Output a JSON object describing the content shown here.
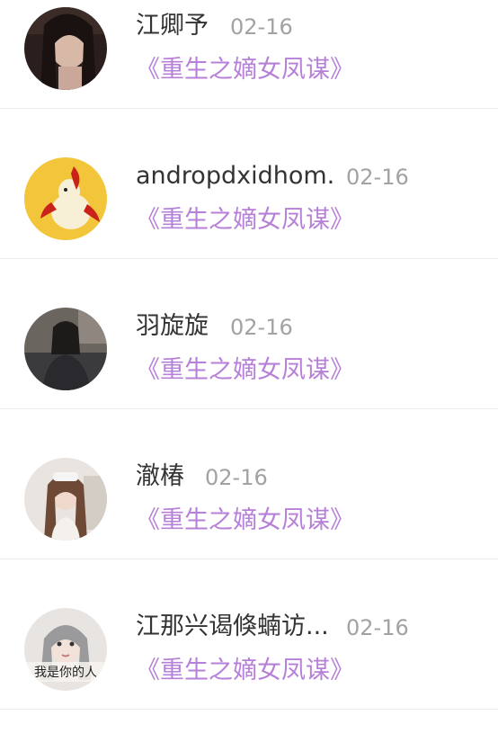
{
  "colors": {
    "name_text": "#333333",
    "date_text": "#a2a2a2",
    "book_link": "#b780d8",
    "divider": "#ededed"
  },
  "comments": [
    {
      "name": "江卿予",
      "date": "02-16",
      "book": "《重生之嫡女凤谋》",
      "avatar": "avatar-girl-dark-hair"
    },
    {
      "name": "andropdxidhom.",
      "date": "02-16",
      "book": "《重生之嫡女凤谋》",
      "avatar": "avatar-yellow-chili-toy"
    },
    {
      "name": "羽旋旋",
      "date": "02-16",
      "book": "《重生之嫡女凤谋》",
      "avatar": "avatar-girl-on-sofa"
    },
    {
      "name": "澈椿",
      "date": "02-16",
      "book": "《重生之嫡女凤谋》",
      "avatar": "avatar-girl-selfie"
    },
    {
      "name": "江那兴谒倏蝻访...",
      "date": "02-16",
      "book": "《重生之嫡女凤谋》",
      "avatar": "avatar-girl-text",
      "avatar_caption": "我是你的人"
    }
  ]
}
